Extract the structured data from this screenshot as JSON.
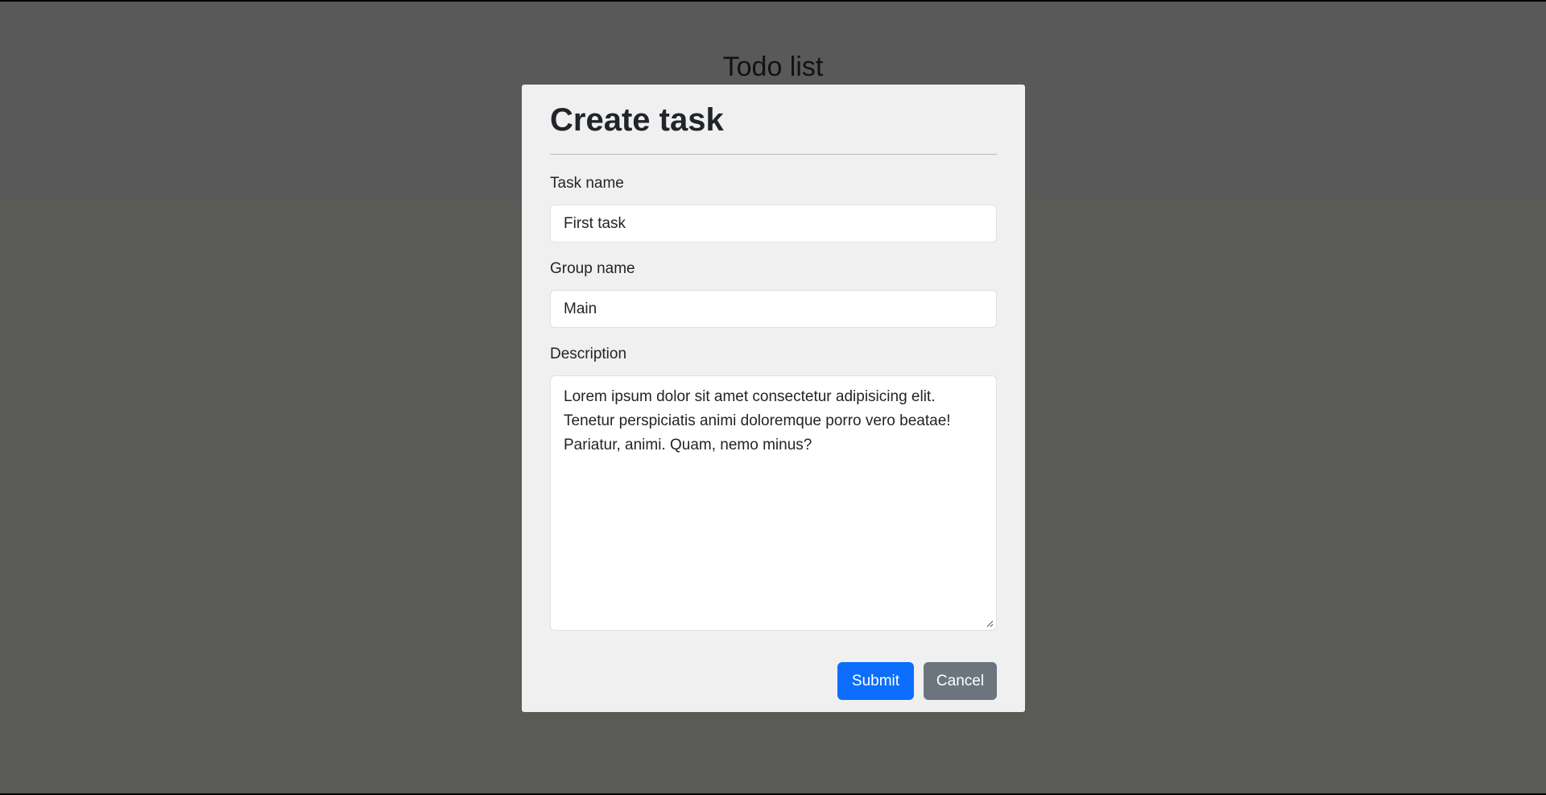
{
  "app": {
    "title": "Todo list"
  },
  "modal": {
    "title": "Create task",
    "fields": {
      "task_name": {
        "label": "Task name",
        "value": "First task"
      },
      "group_name": {
        "label": "Group name",
        "value": "Main"
      },
      "description": {
        "label": "Description",
        "value": "Lorem ipsum dolor sit amet consectetur adipisicing elit.\nTenetur perspiciatis animi doloremque porro vero beatae!\nPariatur, animi. Quam, nemo minus?"
      }
    },
    "buttons": {
      "submit": "Submit",
      "cancel": "Cancel"
    }
  },
  "colors": {
    "primary": "#0d6efd",
    "secondary": "#6c757d",
    "modal_background": "#f0f0f0",
    "backdrop": "rgba(0,0,0,0.5)"
  },
  "icons": {
    "textarea_resize": "resize-grip-icon"
  }
}
